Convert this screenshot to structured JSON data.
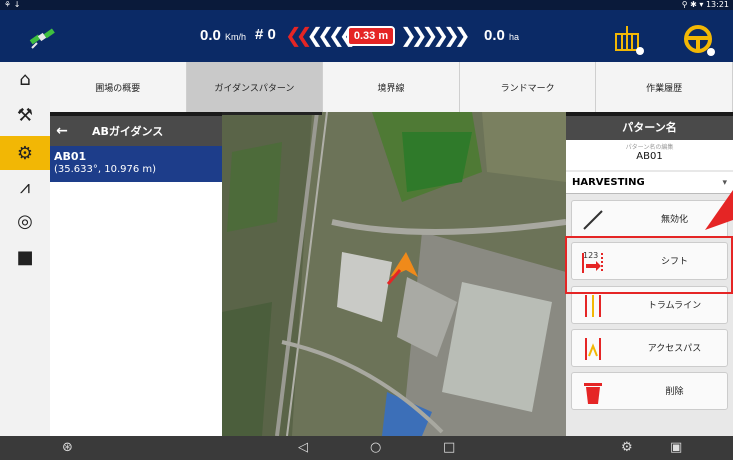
{
  "statusbar": {
    "time": "13:21"
  },
  "topbar": {
    "speed_value": "0.0",
    "speed_unit": "Km/h",
    "line_number": "# 0",
    "offset": "0.33 m",
    "area_value": "0.0",
    "area_unit": "ha"
  },
  "tabs": [
    {
      "label": "圃場の概要"
    },
    {
      "label": "ガイダンスパターン"
    },
    {
      "label": "境界線"
    },
    {
      "label": "ランドマーク"
    },
    {
      "label": "作業履歴"
    }
  ],
  "left_panel": {
    "title": "ABガイダンス",
    "items": [
      {
        "name": "AB01",
        "coord": "(35.633°, 10.976 m)"
      }
    ]
  },
  "right_panel": {
    "title": "パターン名",
    "edit_label": "パターン名の編集",
    "pattern_name": "AB01",
    "mode": "HARVESTING",
    "actions": [
      {
        "label": "無効化",
        "icon": "disable-line-icon"
      },
      {
        "label": "シフト",
        "icon": "shift-icon"
      },
      {
        "label": "トラムライン",
        "icon": "tramline-icon"
      },
      {
        "label": "アクセスパス",
        "icon": "access-path-icon"
      },
      {
        "label": "削除",
        "icon": "trash-icon"
      }
    ]
  },
  "colors": {
    "topbar": "#0b2a66",
    "accent": "#f2b705",
    "alert": "#e52525",
    "selected_item": "#1d3d8a"
  }
}
